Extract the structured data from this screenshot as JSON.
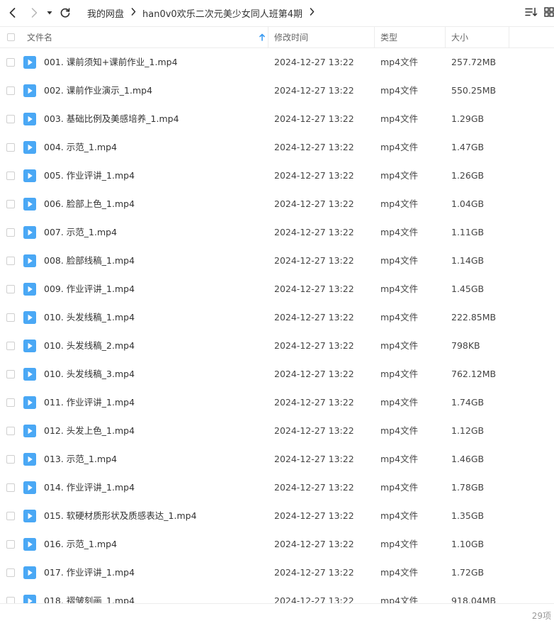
{
  "breadcrumb": [
    "我的网盘",
    "han0v0欢乐二次元美少女同人班第4期"
  ],
  "columns": {
    "name": "文件名",
    "modified": "修改时间",
    "type": "类型",
    "size": "大小"
  },
  "files": [
    {
      "name": "001. 课前须知+课前作业_1.mp4",
      "modified": "2024-12-27 13:22",
      "type": "mp4文件",
      "size": "257.72MB"
    },
    {
      "name": "002. 课前作业演示_1.mp4",
      "modified": "2024-12-27 13:22",
      "type": "mp4文件",
      "size": "550.25MB"
    },
    {
      "name": "003. 基础比例及美感培养_1.mp4",
      "modified": "2024-12-27 13:22",
      "type": "mp4文件",
      "size": "1.29GB"
    },
    {
      "name": "004. 示范_1.mp4",
      "modified": "2024-12-27 13:22",
      "type": "mp4文件",
      "size": "1.47GB"
    },
    {
      "name": "005. 作业评讲_1.mp4",
      "modified": "2024-12-27 13:22",
      "type": "mp4文件",
      "size": "1.26GB"
    },
    {
      "name": "006. 脸部上色_1.mp4",
      "modified": "2024-12-27 13:22",
      "type": "mp4文件",
      "size": "1.04GB"
    },
    {
      "name": "007. 示范_1.mp4",
      "modified": "2024-12-27 13:22",
      "type": "mp4文件",
      "size": "1.11GB"
    },
    {
      "name": "008. 脸部线稿_1.mp4",
      "modified": "2024-12-27 13:22",
      "type": "mp4文件",
      "size": "1.14GB"
    },
    {
      "name": "009. 作业评讲_1.mp4",
      "modified": "2024-12-27 13:22",
      "type": "mp4文件",
      "size": "1.45GB"
    },
    {
      "name": "010. 头发线稿_1.mp4",
      "modified": "2024-12-27 13:22",
      "type": "mp4文件",
      "size": "222.85MB"
    },
    {
      "name": "010. 头发线稿_2.mp4",
      "modified": "2024-12-27 13:22",
      "type": "mp4文件",
      "size": "798KB"
    },
    {
      "name": "010. 头发线稿_3.mp4",
      "modified": "2024-12-27 13:22",
      "type": "mp4文件",
      "size": "762.12MB"
    },
    {
      "name": "011. 作业评讲_1.mp4",
      "modified": "2024-12-27 13:22",
      "type": "mp4文件",
      "size": "1.74GB"
    },
    {
      "name": "012. 头发上色_1.mp4",
      "modified": "2024-12-27 13:22",
      "type": "mp4文件",
      "size": "1.12GB"
    },
    {
      "name": "013. 示范_1.mp4",
      "modified": "2024-12-27 13:22",
      "type": "mp4文件",
      "size": "1.46GB"
    },
    {
      "name": "014. 作业评讲_1.mp4",
      "modified": "2024-12-27 13:22",
      "type": "mp4文件",
      "size": "1.78GB"
    },
    {
      "name": "015. 软硬材质形状及质感表达_1.mp4",
      "modified": "2024-12-27 13:22",
      "type": "mp4文件",
      "size": "1.35GB"
    },
    {
      "name": "016. 示范_1.mp4",
      "modified": "2024-12-27 13:22",
      "type": "mp4文件",
      "size": "1.10GB"
    },
    {
      "name": "017. 作业评讲_1.mp4",
      "modified": "2024-12-27 13:22",
      "type": "mp4文件",
      "size": "1.72GB"
    },
    {
      "name": "018. 褶皱刻画_1.mp4",
      "modified": "2024-12-27 13:22",
      "type": "mp4文件",
      "size": "918.04MB"
    }
  ],
  "footer": {
    "count": "29项"
  },
  "colors": {
    "accent": "#3a9bf2",
    "file_icon": "#4aa8f5",
    "border": "#ececec"
  },
  "icons": {
    "back": "chevron-left-icon",
    "forward": "chevron-right-icon",
    "history": "caret-down-icon",
    "refresh": "refresh-icon",
    "sort": "sort-list-icon",
    "view": "grid-view-icon",
    "file": "video-file-icon"
  }
}
